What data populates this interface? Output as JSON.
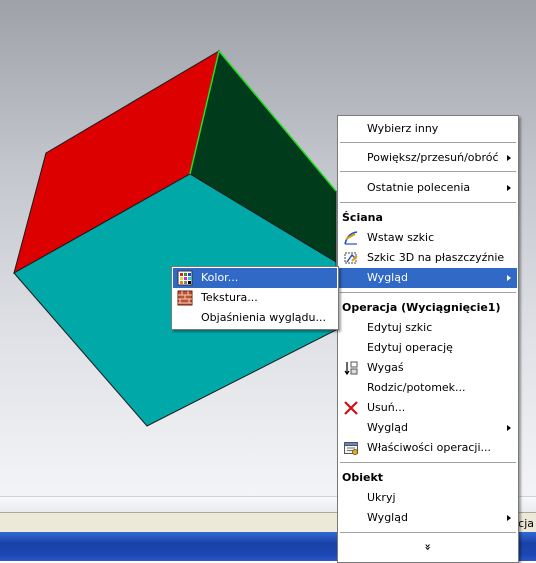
{
  "colors": {
    "face_top_left": "#dc0000",
    "face_top_right": "#003b1c",
    "face_front": "#00a8a8",
    "edge_highlight": "#22e022",
    "menu_highlight": "#3169c6"
  },
  "context_menu": {
    "general_items": [
      {
        "label": "Wybierz inny",
        "submenu": false
      },
      {
        "label": "Powiększ/przesuń/obróć",
        "submenu": true
      },
      {
        "label": "Ostatnie polecenia",
        "submenu": true
      }
    ],
    "face_section": {
      "header": "Ściana",
      "items": [
        {
          "label": "Wstaw szkic",
          "icon": "insert-sketch-icon"
        },
        {
          "label": "Szkic 3D na płaszczyźnie",
          "icon": "3d-sketch-icon"
        },
        {
          "label": "Wygląd",
          "submenu": true,
          "highlighted": true
        }
      ]
    },
    "feature_section": {
      "header": "Operacja (Wyciągnięcie1)",
      "items": [
        {
          "label": "Edytuj szkic"
        },
        {
          "label": "Edytuj operację"
        },
        {
          "label": "Wygaś",
          "icon": "suppress-icon"
        },
        {
          "label": "Rodzic/potomek..."
        },
        {
          "label": "Usuń...",
          "icon": "delete-icon"
        },
        {
          "label": "Wygląd",
          "submenu": true
        },
        {
          "label": "Właściwości operacji...",
          "icon": "properties-icon"
        }
      ]
    },
    "body_section": {
      "header": "Obiekt",
      "items": [
        {
          "label": "Ukryj"
        },
        {
          "label": "Wygląd",
          "submenu": true
        }
      ]
    },
    "expand_glyph": "»"
  },
  "appearance_submenu": {
    "items": [
      {
        "label": "Kolor...",
        "icon": "color-palette-icon",
        "highlighted": true
      },
      {
        "label": "Tekstura...",
        "icon": "texture-brick-icon"
      },
      {
        "label": "Objaśnienia wyglądu...",
        "icon": ""
      }
    ]
  },
  "statusbar": {
    "text": "cja"
  }
}
